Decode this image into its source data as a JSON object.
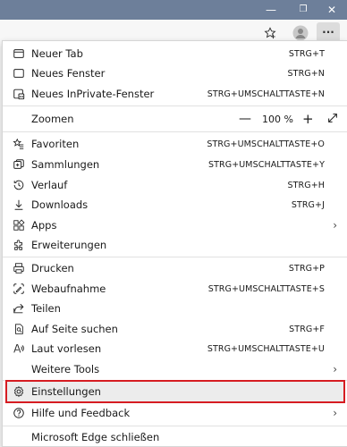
{
  "window": {
    "minimize_glyph": "—",
    "restore_glyph": "❐",
    "close_glyph": "✕"
  },
  "toolbar": {
    "favorite_icon": "star-plus-icon",
    "profile_icon": "profile-avatar-icon",
    "more_glyph": "···"
  },
  "menu": {
    "items": [
      {
        "label": "Neuer Tab",
        "shortcut": "STRG+T",
        "icon": "new-tab-icon"
      },
      {
        "label": "Neues Fenster",
        "shortcut": "STRG+N",
        "icon": "new-window-icon"
      },
      {
        "label": "Neues InPrivate-Fenster",
        "shortcut": "STRG+UMSCHALTTASTE+N",
        "icon": "inprivate-icon"
      },
      {
        "label": "Zoomen",
        "zoom_value": "100 %",
        "minus": "—",
        "plus": "+",
        "icon": "zoom"
      },
      {
        "label": "Favoriten",
        "shortcut": "STRG+UMSCHALTTASTE+O",
        "icon": "favorites-icon"
      },
      {
        "label": "Sammlungen",
        "shortcut": "STRG+UMSCHALTTASTE+Y",
        "icon": "collections-icon"
      },
      {
        "label": "Verlauf",
        "shortcut": "STRG+H",
        "icon": "history-icon"
      },
      {
        "label": "Downloads",
        "shortcut": "STRG+J",
        "icon": "download-icon"
      },
      {
        "label": "Apps",
        "chevron": "›",
        "icon": "apps-icon"
      },
      {
        "label": "Erweiterungen",
        "icon": "extensions-icon"
      },
      {
        "label": "Drucken",
        "shortcut": "STRG+P",
        "icon": "print-icon"
      },
      {
        "label": "Webaufnahme",
        "shortcut": "STRG+UMSCHALTTASTE+S",
        "icon": "web-capture-icon"
      },
      {
        "label": "Teilen",
        "icon": "share-icon"
      },
      {
        "label": "Auf Seite suchen",
        "shortcut": "STRG+F",
        "icon": "find-icon"
      },
      {
        "label": "Laut vorlesen",
        "shortcut": "STRG+UMSCHALTTASTE+U",
        "icon": "read-aloud-icon"
      },
      {
        "label": "Weitere Tools",
        "chevron": "›"
      },
      {
        "label": "Einstellungen",
        "icon": "settings-icon"
      },
      {
        "label": "Hilfe und Feedback",
        "chevron": "›",
        "icon": "help-icon"
      },
      {
        "label": "Microsoft Edge schließen"
      }
    ]
  },
  "colors": {
    "highlight_border": "#d61c22",
    "titlebar": "#6d7f9a"
  }
}
